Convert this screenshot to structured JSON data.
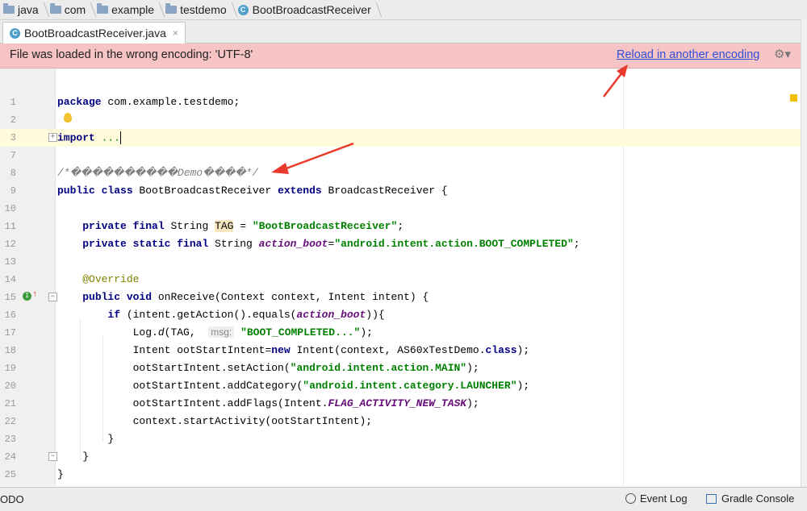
{
  "breadcrumb": [
    "java",
    "com",
    "example",
    "testdemo",
    "BootBroadcastReceiver"
  ],
  "tab": {
    "label": "BootBroadcastReceiver.java",
    "close": "×"
  },
  "warning": {
    "message": "File was loaded in the wrong encoding: 'UTF-8'",
    "link": "Reload in another encoding"
  },
  "line_numbers": [
    "1",
    "2",
    "3",
    "7",
    "8",
    "9",
    "10",
    "11",
    "12",
    "13",
    "14",
    "15",
    "16",
    "17",
    "18",
    "19",
    "20",
    "21",
    "22",
    "23",
    "24",
    "25"
  ],
  "code": {
    "l1_kw": "package",
    "l1_rest": " com.example.testdemo;",
    "l3_kw": "import",
    "l3_rest": " ...",
    "l8_comment": "/*����������Demo����*/",
    "l9_kw1": "public class",
    "l9_mid": " BootBroadcastReceiver ",
    "l9_kw2": "extends",
    "l9_rest": " BroadcastReceiver {",
    "l11_kw": "private final",
    "l11_type": " String ",
    "l11_name": "TAG",
    "l11_eq": " = ",
    "l11_str": "\"BootBroadcastReceiver\"",
    "l11_end": ";",
    "l12_kw": "private static final",
    "l12_type": " String ",
    "l12_name": "action_boot",
    "l12_eq": "=",
    "l12_str": "\"android.intent.action.BOOT_COMPLETED\"",
    "l12_end": ";",
    "l14_ann": "@Override",
    "l15_kw": "public void",
    "l15_rest": " onReceive(Context context, Intent intent) {",
    "l16_kw": "if",
    "l16_a": " (intent.getAction().equals(",
    "l16_field": "action_boot",
    "l16_b": ")){",
    "l17_a": "Log.",
    "l17_d": "d",
    "l17_b": "(TAG,  ",
    "l17_param": "msg:",
    "l17_str": " \"BOOT_COMPLETED...\"",
    "l17_end": ");",
    "l18_a": "Intent ootStartIntent=",
    "l18_kw": "new",
    "l18_b": " Intent(context, AS60xTestDemo.",
    "l18_kw2": "class",
    "l18_end": ");",
    "l19_a": "ootStartIntent.setAction(",
    "l19_str": "\"android.intent.action.MAIN\"",
    "l19_end": ");",
    "l20_a": "ootStartIntent.addCategory(",
    "l20_str": "\"android.intent.category.LAUNCHER\"",
    "l20_end": ");",
    "l21_a": "ootStartIntent.addFlags(Intent.",
    "l21_field": "FLAG_ACTIVITY_NEW_TASK",
    "l21_end": ");",
    "l22": "context.startActivity(ootStartIntent);",
    "l23": "}",
    "l24": "}",
    "l25": "}"
  },
  "statusbar": {
    "todo": "ODO",
    "event_log": "Event Log",
    "gradle_console": "Gradle Console"
  }
}
